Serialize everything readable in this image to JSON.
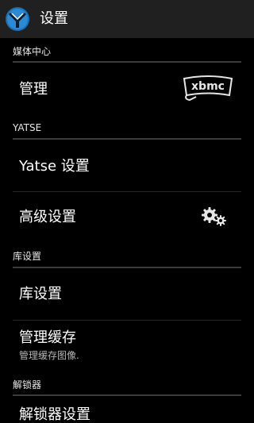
{
  "actionbar": {
    "title": "设置",
    "icon": "yatse-logo-icon"
  },
  "sections": [
    {
      "header": "媒体中心",
      "items": [
        {
          "title": "管理",
          "icon": "xbmc-logo-icon",
          "icon_text": "xbmc"
        }
      ]
    },
    {
      "header": "YATSE",
      "items": [
        {
          "title": "Yatse 设置"
        },
        {
          "title": "高级设置",
          "icon": "gears-icon"
        }
      ]
    },
    {
      "header": "库设置",
      "items": [
        {
          "title": "库设置"
        },
        {
          "title": "管理缓存",
          "summary": "管理缓存图像."
        }
      ]
    },
    {
      "header": "解锁器",
      "items": [
        {
          "title": "解锁器设置"
        }
      ]
    }
  ],
  "colors": {
    "actionbar_bg": "#202020",
    "page_bg": "#000000",
    "header_rule": "#3c3c3c",
    "summary_text": "#b5b5b5"
  }
}
